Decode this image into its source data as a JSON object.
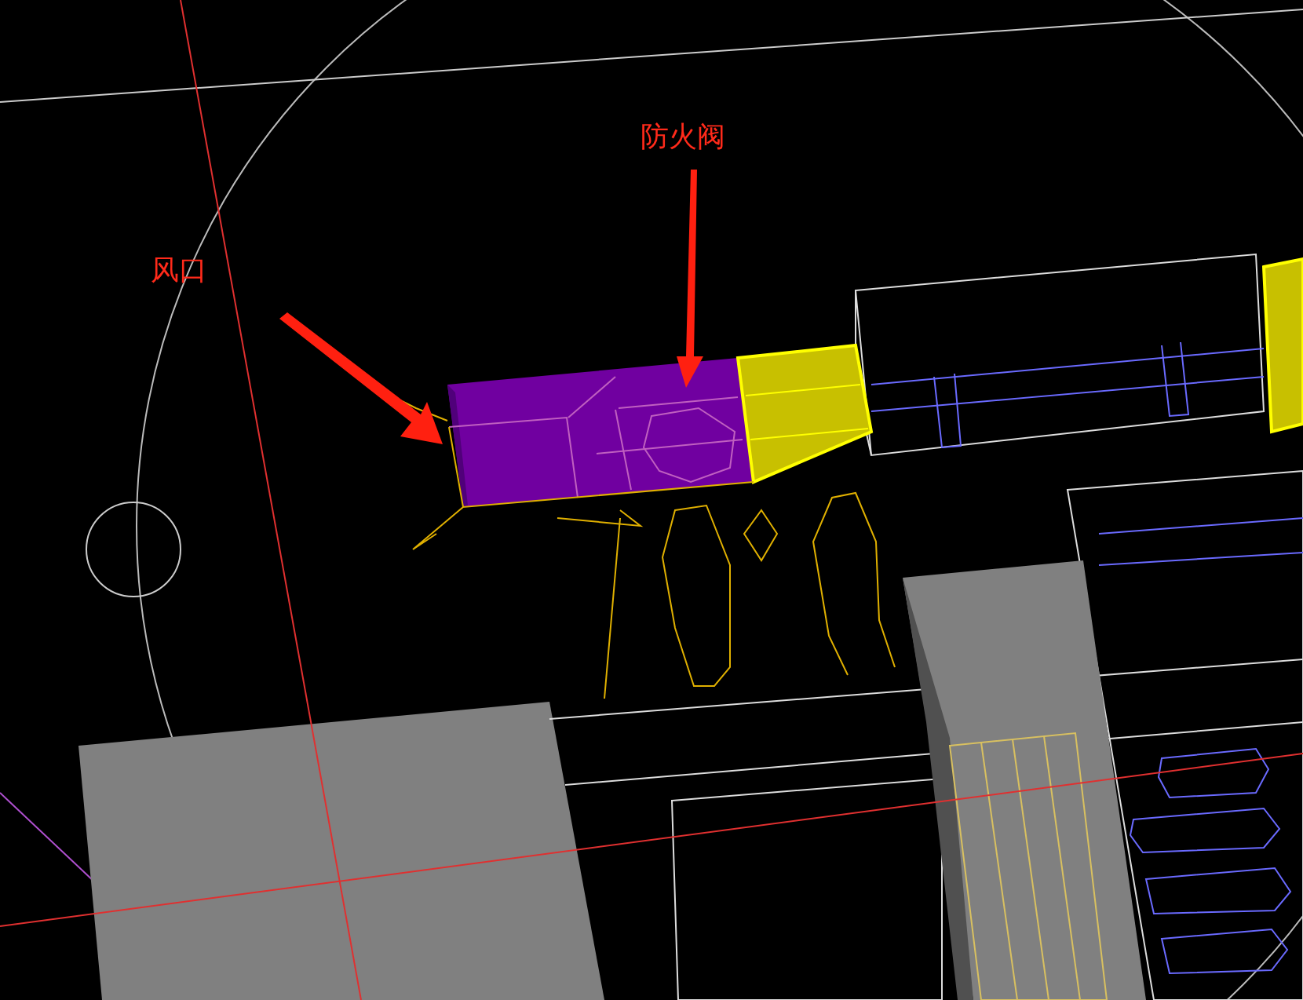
{
  "viewport": {
    "annotations": [
      {
        "label": "风口"
      },
      {
        "label": "防火阀"
      }
    ]
  }
}
